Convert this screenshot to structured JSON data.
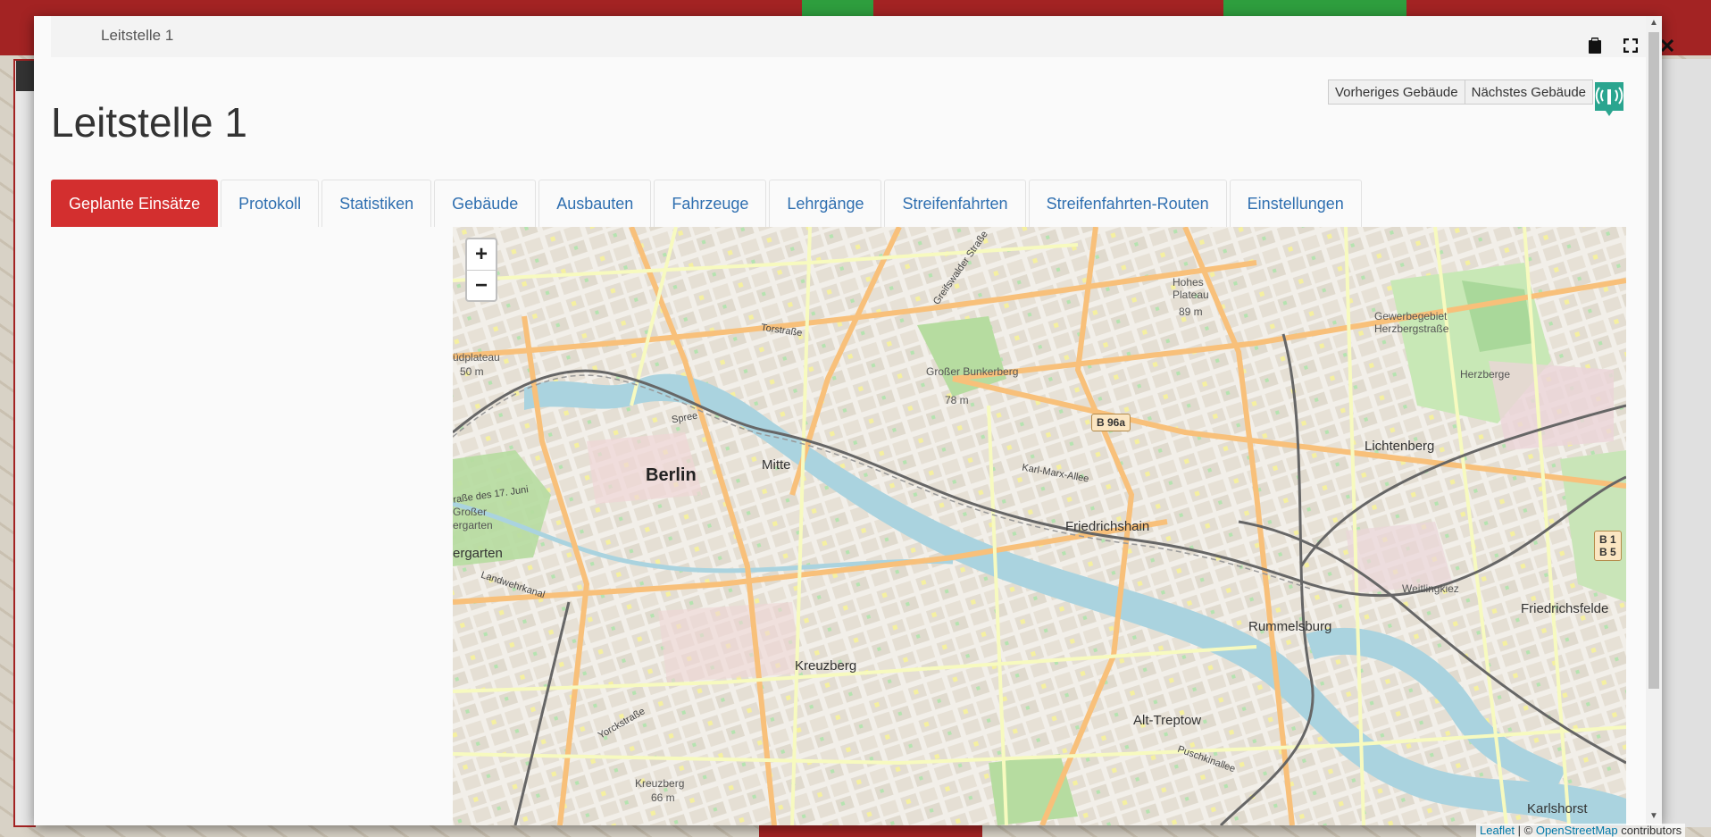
{
  "modal": {
    "header_title": "Leitstelle 1",
    "page_title": "Leitstelle 1",
    "nav": {
      "previous_label": "Vorheriges Gebäude",
      "next_label": "Nächstes Gebäude"
    },
    "icons": [
      "clipboard-icon",
      "expand-icon",
      "close-icon",
      "radio-tower-icon"
    ]
  },
  "tabs": [
    {
      "label": "Geplante Einsätze",
      "active": true
    },
    {
      "label": "Protokoll"
    },
    {
      "label": "Statistiken"
    },
    {
      "label": "Gebäude"
    },
    {
      "label": "Ausbauten"
    },
    {
      "label": "Fahrzeuge"
    },
    {
      "label": "Lehrgänge"
    },
    {
      "label": "Streifenfahrten"
    },
    {
      "label": "Streifenfahrten-Routen"
    },
    {
      "label": "Einstellungen"
    }
  ],
  "map": {
    "zoom_in": "+",
    "zoom_out": "−",
    "labels": {
      "berlin": "Berlin",
      "mitte": "Mitte",
      "friedrichshain": "Friedrichshain",
      "lichtenberg": "Lichtenberg",
      "kreuzberg": "Kreuzberg",
      "rummelsburg": "Rummelsburg",
      "friedrichsfelde": "Friedrichsfelde",
      "alt_treptow": "Alt-Treptow",
      "karlshorst": "Karlshorst",
      "herzberge": "Herzberge",
      "gewerbegebiet": "Gewerbegebiet Herzbergstraße",
      "grosser_bunkerberg": "Großer Bunkerberg",
      "bunkerberg_height": "78 m",
      "hohes_plateau": "Hohes Plateau",
      "plateau_height": "89 m",
      "suedplateau": "üdplateau",
      "suedplateau_height": "50 m",
      "kreuzberg_hill": "Kreuzberg",
      "kreuzberg_hill_height": "66 m",
      "weitlingkiez": "Weitlingkiez",
      "grosser_tiergarten": "Großer",
      "ergarten": "ergarten",
      "ergarten2": "ergarten",
      "landwehrkanal": "Landwehrkanal",
      "spree": "Spree",
      "karl_marx_allee": "Karl-Marx-Allee",
      "torstrasse": "Torstraße",
      "greifswalder": "Greifswalder Straße",
      "yorckstrasse": "Yorckstraße",
      "puschkinallee": "Puschkinallee",
      "strasse_17_juni": "raße des 17. Juni",
      "b96a": "B 96a",
      "b1b5": "B 1\nB 5"
    }
  },
  "attribution": {
    "leaflet": "Leaflet",
    "sep": " | © ",
    "osm": "OpenStreetMap",
    "tail": " contributors"
  }
}
